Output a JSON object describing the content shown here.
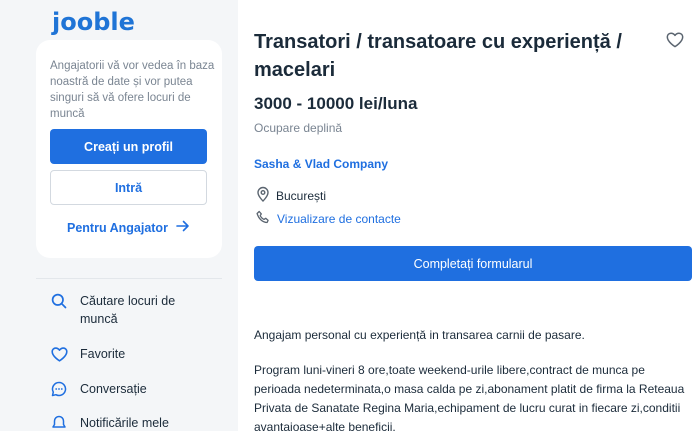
{
  "sidebar": {
    "logo": "jooble",
    "card_text": "Angajatorii vă vor vedea în baza noastră de date și vor putea singuri să vă ofere locuri de muncă",
    "create_profile_label": "Creați un profil",
    "login_label": "Intră",
    "employer_label": "Pentru Angajator",
    "nav": [
      {
        "label": "Căutare locuri de muncă",
        "icon": "search-icon"
      },
      {
        "label": "Favorite",
        "icon": "heart-icon"
      },
      {
        "label": "Conversație",
        "icon": "chat-icon"
      },
      {
        "label": "Notificările mele",
        "icon": "bell-icon"
      }
    ]
  },
  "job": {
    "title": "Transatori / transatoare cu experiență / macelari",
    "salary": "3000 - 10000 lei/luna",
    "employment": "Ocupare deplină",
    "company": "Sasha & Vlad Company",
    "location": "București",
    "contacts_label": "Vizualizare de contacte",
    "apply_label": "Completați formularul",
    "description": [
      "Angajam personal cu experiență in transarea carnii de pasare.",
      "Program luni-vineri 8 ore,toate weekend-urile libere,contract de munca pe perioada nedeterminata,o masa calda pe zi,abonament platit de firma la Reteaua Privata de Sanatate Regina Maria,echipament de lucru curat in fiecare zi,conditii avantajoase+alte beneficii."
    ]
  },
  "colors": {
    "accent": "#1f6fe0",
    "sidebar_bg": "#f4f6f8",
    "text": "#1b2b3a",
    "muted": "#7a8592"
  }
}
